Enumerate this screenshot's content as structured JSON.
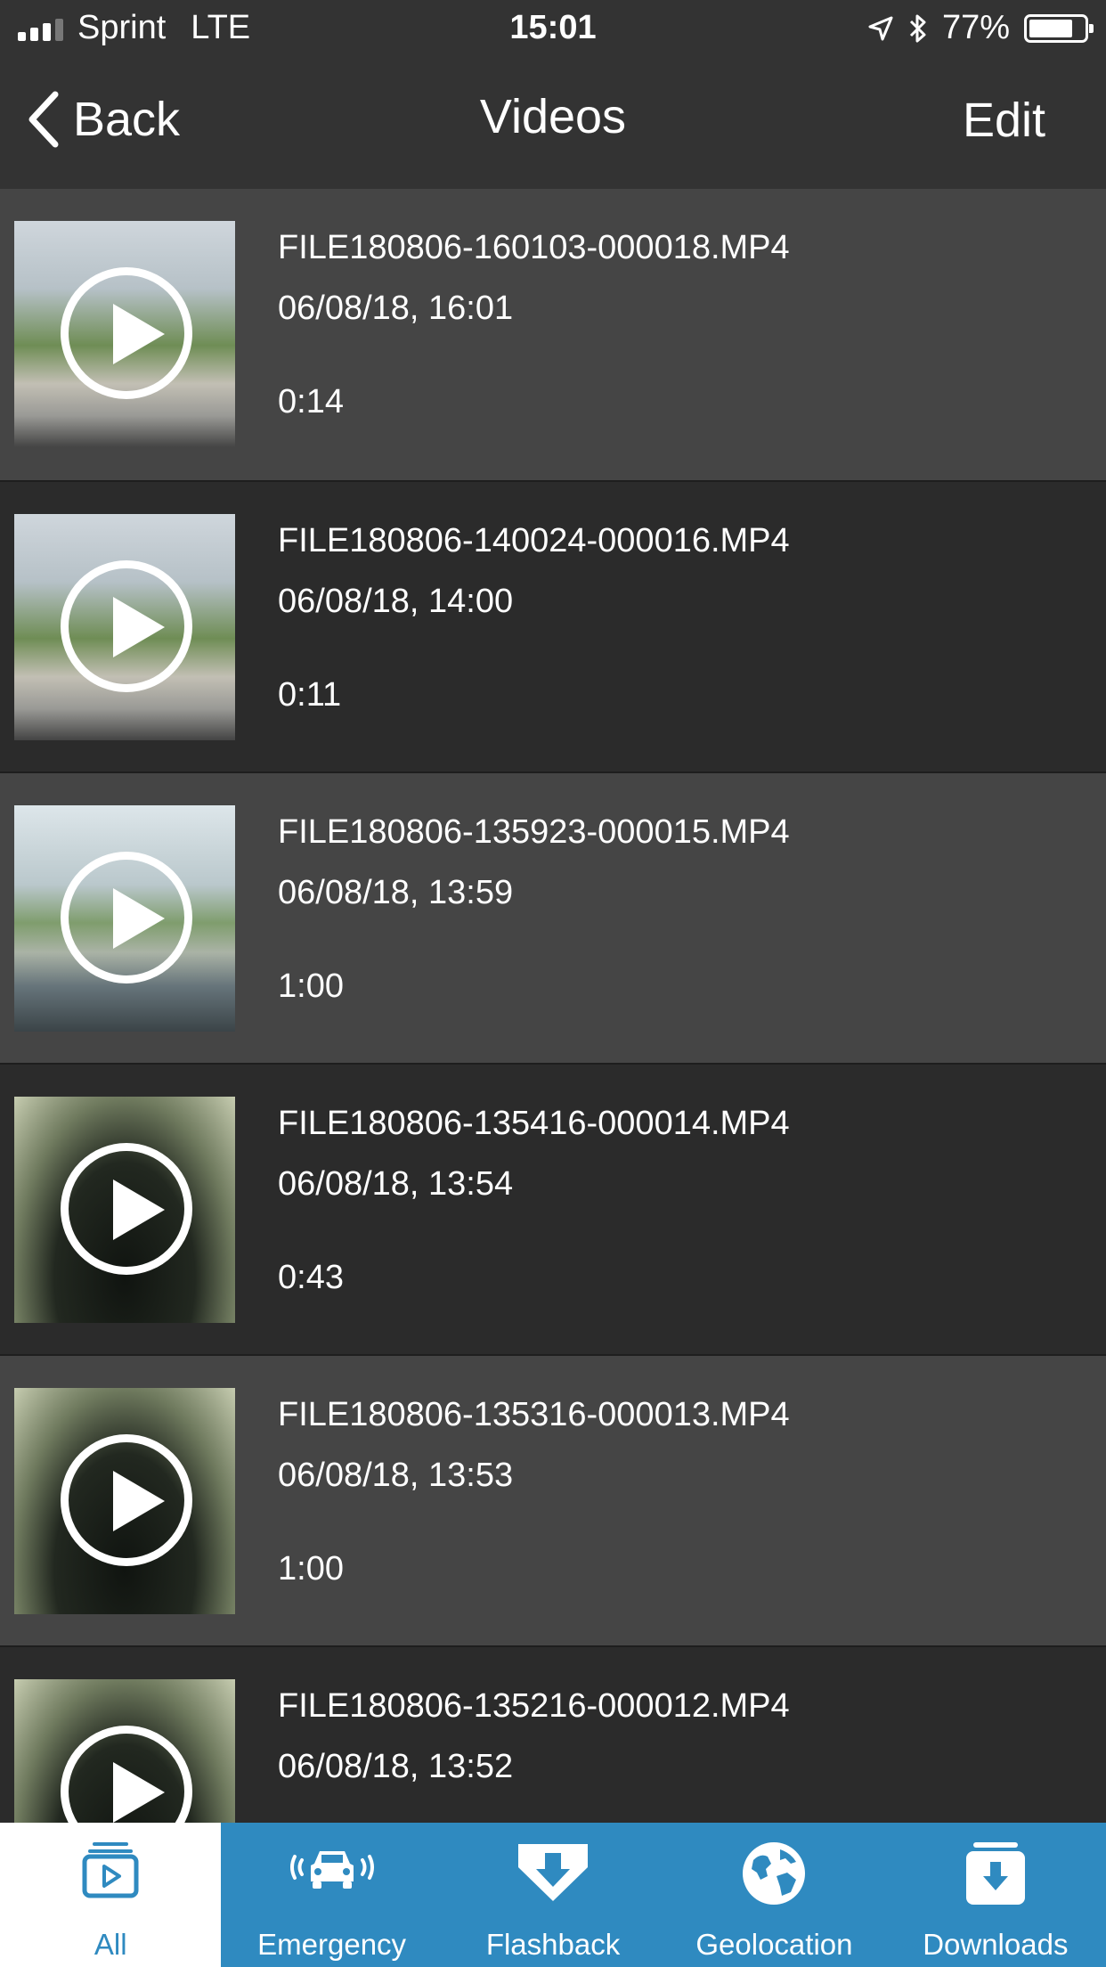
{
  "statusbar": {
    "carrier": "Sprint",
    "network": "LTE",
    "time": "15:01",
    "battery": "77%"
  },
  "nav": {
    "back_label": "Back",
    "title": "Videos",
    "edit_label": "Edit"
  },
  "videos": [
    {
      "name": "FILE180806-160103-000018.MP4",
      "date": "06/08/18, 16:01",
      "duration": "0:14"
    },
    {
      "name": "FILE180806-140024-000016.MP4",
      "date": "06/08/18, 14:00",
      "duration": "0:11"
    },
    {
      "name": "FILE180806-135923-000015.MP4",
      "date": "06/08/18, 13:59",
      "duration": "1:00"
    },
    {
      "name": "FILE180806-135416-000014.MP4",
      "date": "06/08/18, 13:54",
      "duration": "0:43"
    },
    {
      "name": "FILE180806-135316-000013.MP4",
      "date": "06/08/18, 13:53",
      "duration": "1:00"
    },
    {
      "name": "FILE180806-135216-000012.MP4",
      "date": "06/08/18, 13:52",
      "duration": ""
    }
  ],
  "tabs": [
    {
      "label": "All",
      "icon": "video-library-icon",
      "active": true
    },
    {
      "label": "Emergency",
      "icon": "car-emergency-icon",
      "active": false
    },
    {
      "label": "Flashback",
      "icon": "flashback-arrow-icon",
      "active": false
    },
    {
      "label": "Geolocation",
      "icon": "globe-icon",
      "active": false
    },
    {
      "label": "Downloads",
      "icon": "download-box-icon",
      "active": false
    }
  ],
  "colors": {
    "tab_bar": "#2f8ac0",
    "header": "#333333",
    "row_light": "#454545",
    "row_dark": "#2b2b2b"
  }
}
